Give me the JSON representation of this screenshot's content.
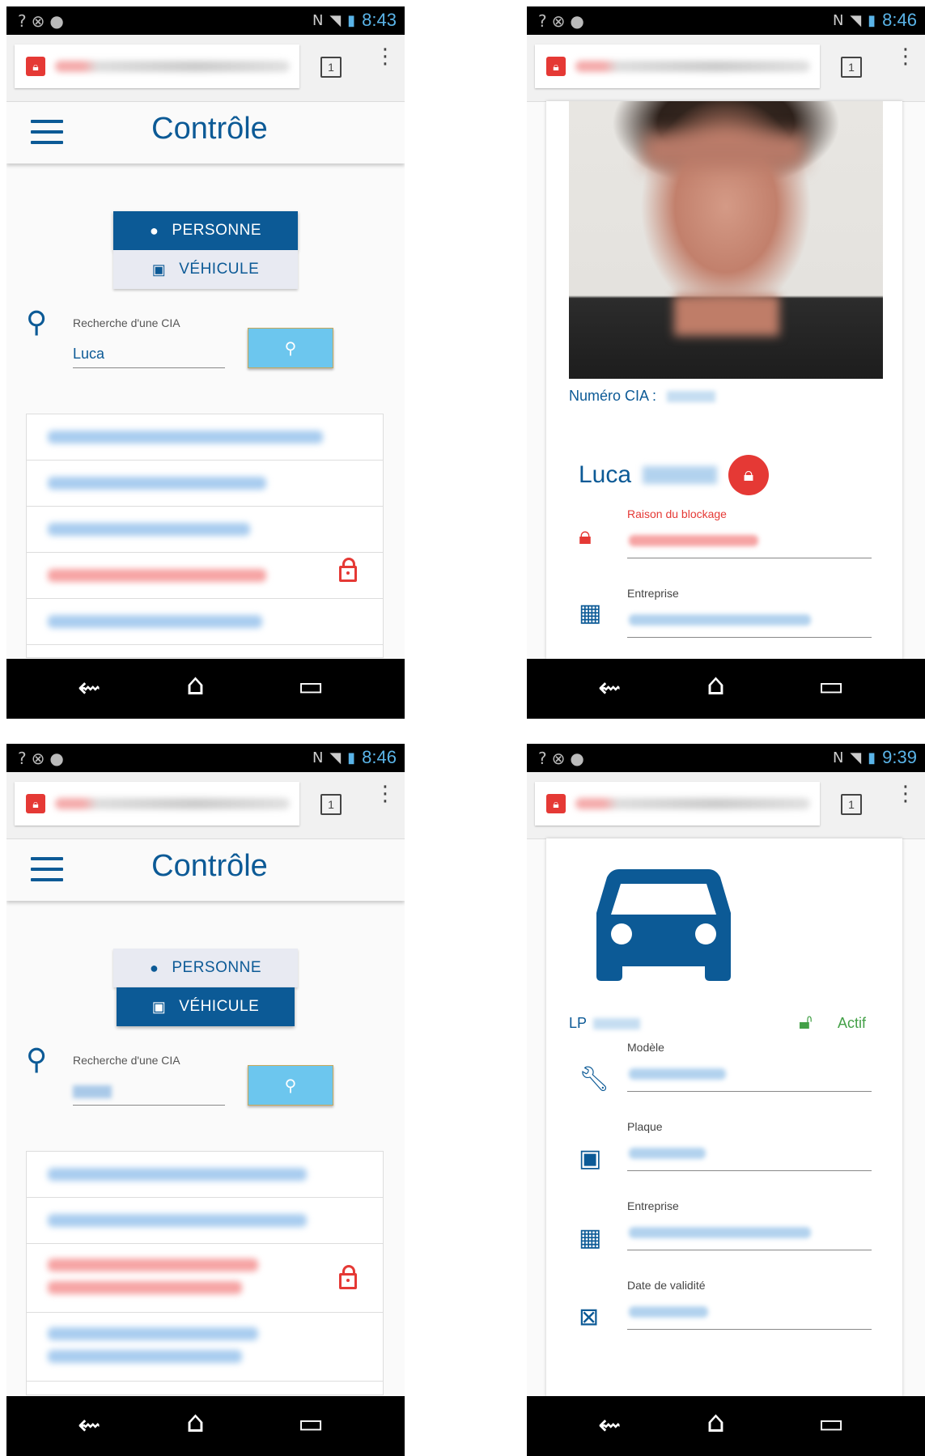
{
  "status": {
    "icons_left": [
      "wifi-question-icon",
      "no-signal-icon",
      "android-icon"
    ],
    "icons_right": [
      "nfc-icon",
      "vibrate-icon",
      "wifi-icon",
      "signal-icon",
      "battery-icon"
    ]
  },
  "browser": {
    "tab_count": "1",
    "menu_glyph": "⋮"
  },
  "screens": [
    {
      "time": "8:43",
      "app_title": "Contrôle",
      "segment": {
        "person_label": "PERSONNE",
        "vehicle_label": "VÉHICULE",
        "active": "person"
      },
      "search": {
        "label": "Recherche d'une CIA",
        "value": "Luca"
      }
    },
    {
      "time": "8:46",
      "cia_label": "Numéro CIA :",
      "person_first_name": "Luca",
      "fields": [
        {
          "label": "Raison du blockage"
        },
        {
          "label": "Entreprise"
        }
      ]
    },
    {
      "time": "8:46",
      "app_title": "Contrôle",
      "segment": {
        "person_label": "PERSONNE",
        "vehicle_label": "VÉHICULE",
        "active": "vehicle"
      },
      "search": {
        "label": "Recherche d'une CIA",
        "value": ""
      }
    },
    {
      "time": "9:39",
      "plate_prefix": "LP",
      "status_label": "Actif",
      "fields": [
        {
          "label": "Modèle"
        },
        {
          "label": "Plaque"
        },
        {
          "label": "Entreprise"
        },
        {
          "label": "Date de validité"
        }
      ]
    }
  ],
  "colors": {
    "primary": "#0c5a96",
    "accent_search": "#6cc6ee",
    "blocked": "#e53935",
    "active": "#43a047",
    "time": "#5ab4e8"
  }
}
